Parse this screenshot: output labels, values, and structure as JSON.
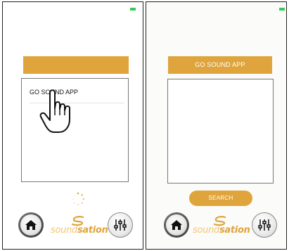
{
  "colors": {
    "accent": "#e0a43c",
    "battery": "#33cc55",
    "border": "#222222"
  },
  "left_screen": {
    "title_bar_text": "",
    "devices": [
      {
        "name": "GO SOUND APP"
      }
    ],
    "loading_icon": "spinner-icon",
    "tap_gesture_icon": "hand-pointer-icon"
  },
  "right_screen": {
    "title_bar_text": "GO SOUND APP",
    "devices": [],
    "search_button_label": "SEARCH"
  },
  "bottom_bar": {
    "home_icon": "home-icon",
    "equalizer_icon": "sliders-icon",
    "logo_text_a": "sound",
    "logo_text_b": "sation"
  }
}
